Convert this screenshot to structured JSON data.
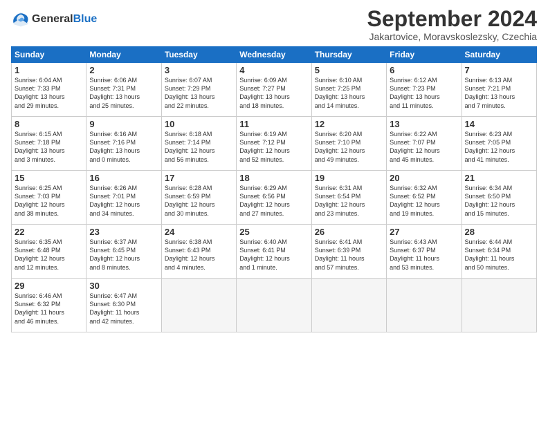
{
  "header": {
    "logo_line1": "General",
    "logo_line2": "Blue",
    "month": "September 2024",
    "location": "Jakartovice, Moravskoslezsky, Czechia"
  },
  "weekdays": [
    "Sunday",
    "Monday",
    "Tuesday",
    "Wednesday",
    "Thursday",
    "Friday",
    "Saturday"
  ],
  "weeks": [
    [
      {
        "day": "1",
        "info": "Sunrise: 6:04 AM\nSunset: 7:33 PM\nDaylight: 13 hours\nand 29 minutes."
      },
      {
        "day": "2",
        "info": "Sunrise: 6:06 AM\nSunset: 7:31 PM\nDaylight: 13 hours\nand 25 minutes."
      },
      {
        "day": "3",
        "info": "Sunrise: 6:07 AM\nSunset: 7:29 PM\nDaylight: 13 hours\nand 22 minutes."
      },
      {
        "day": "4",
        "info": "Sunrise: 6:09 AM\nSunset: 7:27 PM\nDaylight: 13 hours\nand 18 minutes."
      },
      {
        "day": "5",
        "info": "Sunrise: 6:10 AM\nSunset: 7:25 PM\nDaylight: 13 hours\nand 14 minutes."
      },
      {
        "day": "6",
        "info": "Sunrise: 6:12 AM\nSunset: 7:23 PM\nDaylight: 13 hours\nand 11 minutes."
      },
      {
        "day": "7",
        "info": "Sunrise: 6:13 AM\nSunset: 7:21 PM\nDaylight: 13 hours\nand 7 minutes."
      }
    ],
    [
      {
        "day": "8",
        "info": "Sunrise: 6:15 AM\nSunset: 7:18 PM\nDaylight: 13 hours\nand 3 minutes."
      },
      {
        "day": "9",
        "info": "Sunrise: 6:16 AM\nSunset: 7:16 PM\nDaylight: 13 hours\nand 0 minutes."
      },
      {
        "day": "10",
        "info": "Sunrise: 6:18 AM\nSunset: 7:14 PM\nDaylight: 12 hours\nand 56 minutes."
      },
      {
        "day": "11",
        "info": "Sunrise: 6:19 AM\nSunset: 7:12 PM\nDaylight: 12 hours\nand 52 minutes."
      },
      {
        "day": "12",
        "info": "Sunrise: 6:20 AM\nSunset: 7:10 PM\nDaylight: 12 hours\nand 49 minutes."
      },
      {
        "day": "13",
        "info": "Sunrise: 6:22 AM\nSunset: 7:07 PM\nDaylight: 12 hours\nand 45 minutes."
      },
      {
        "day": "14",
        "info": "Sunrise: 6:23 AM\nSunset: 7:05 PM\nDaylight: 12 hours\nand 41 minutes."
      }
    ],
    [
      {
        "day": "15",
        "info": "Sunrise: 6:25 AM\nSunset: 7:03 PM\nDaylight: 12 hours\nand 38 minutes."
      },
      {
        "day": "16",
        "info": "Sunrise: 6:26 AM\nSunset: 7:01 PM\nDaylight: 12 hours\nand 34 minutes."
      },
      {
        "day": "17",
        "info": "Sunrise: 6:28 AM\nSunset: 6:59 PM\nDaylight: 12 hours\nand 30 minutes."
      },
      {
        "day": "18",
        "info": "Sunrise: 6:29 AM\nSunset: 6:56 PM\nDaylight: 12 hours\nand 27 minutes."
      },
      {
        "day": "19",
        "info": "Sunrise: 6:31 AM\nSunset: 6:54 PM\nDaylight: 12 hours\nand 23 minutes."
      },
      {
        "day": "20",
        "info": "Sunrise: 6:32 AM\nSunset: 6:52 PM\nDaylight: 12 hours\nand 19 minutes."
      },
      {
        "day": "21",
        "info": "Sunrise: 6:34 AM\nSunset: 6:50 PM\nDaylight: 12 hours\nand 15 minutes."
      }
    ],
    [
      {
        "day": "22",
        "info": "Sunrise: 6:35 AM\nSunset: 6:48 PM\nDaylight: 12 hours\nand 12 minutes."
      },
      {
        "day": "23",
        "info": "Sunrise: 6:37 AM\nSunset: 6:45 PM\nDaylight: 12 hours\nand 8 minutes."
      },
      {
        "day": "24",
        "info": "Sunrise: 6:38 AM\nSunset: 6:43 PM\nDaylight: 12 hours\nand 4 minutes."
      },
      {
        "day": "25",
        "info": "Sunrise: 6:40 AM\nSunset: 6:41 PM\nDaylight: 12 hours\nand 1 minute."
      },
      {
        "day": "26",
        "info": "Sunrise: 6:41 AM\nSunset: 6:39 PM\nDaylight: 11 hours\nand 57 minutes."
      },
      {
        "day": "27",
        "info": "Sunrise: 6:43 AM\nSunset: 6:37 PM\nDaylight: 11 hours\nand 53 minutes."
      },
      {
        "day": "28",
        "info": "Sunrise: 6:44 AM\nSunset: 6:34 PM\nDaylight: 11 hours\nand 50 minutes."
      }
    ],
    [
      {
        "day": "29",
        "info": "Sunrise: 6:46 AM\nSunset: 6:32 PM\nDaylight: 11 hours\nand 46 minutes."
      },
      {
        "day": "30",
        "info": "Sunrise: 6:47 AM\nSunset: 6:30 PM\nDaylight: 11 hours\nand 42 minutes."
      },
      {
        "day": "",
        "info": ""
      },
      {
        "day": "",
        "info": ""
      },
      {
        "day": "",
        "info": ""
      },
      {
        "day": "",
        "info": ""
      },
      {
        "day": "",
        "info": ""
      }
    ]
  ]
}
